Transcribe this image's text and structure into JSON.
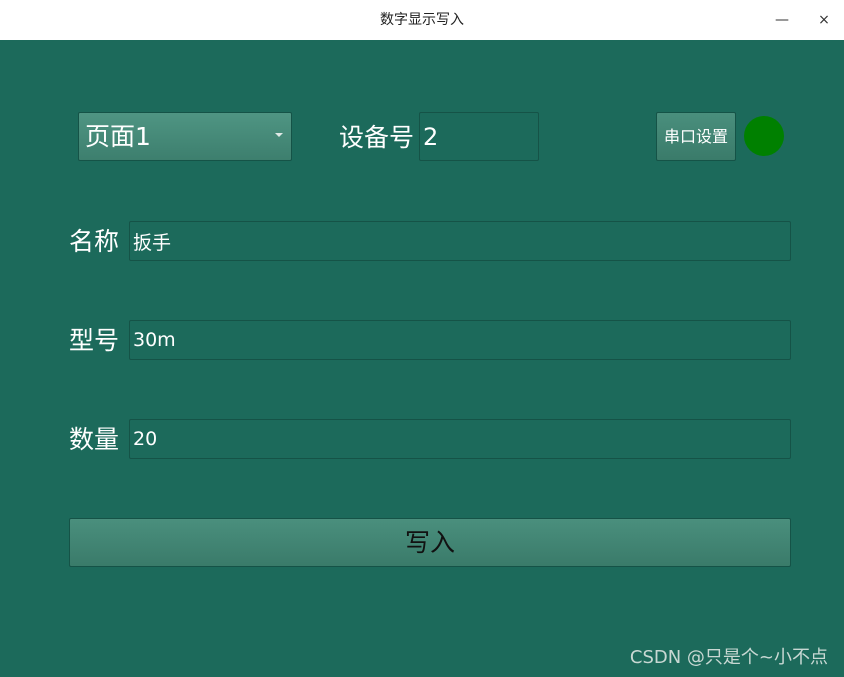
{
  "window": {
    "title": "数字显示写入",
    "minimize_glyph": "—",
    "close_glyph": "×"
  },
  "page_select": {
    "value": "页面1"
  },
  "device": {
    "label": "设备号",
    "value": "2"
  },
  "serial_button": {
    "label": "串口设置"
  },
  "status_indicator": {
    "color": "#008000"
  },
  "fields": {
    "name": {
      "label": "名称",
      "value": "扳手"
    },
    "model": {
      "label": "型号",
      "value": "30m"
    },
    "quantity": {
      "label": "数量",
      "value": "20"
    }
  },
  "write_button": {
    "label": "写入"
  },
  "watermark": "CSDN @只是个~小不点"
}
